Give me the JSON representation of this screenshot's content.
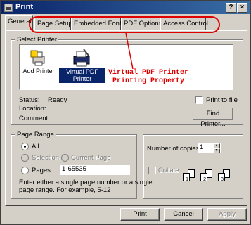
{
  "window": {
    "title": "Print",
    "close_glyph": "×",
    "help_glyph": "?"
  },
  "tabs": [
    {
      "label": "General"
    },
    {
      "label": "Page Setup"
    },
    {
      "label": "Embedded Fonts"
    },
    {
      "label": "PDF Options"
    },
    {
      "label": "Access Control"
    }
  ],
  "select_printer": {
    "group_title": "Select Printer",
    "printers": [
      {
        "label": "Add Printer",
        "icon": "add-printer-icon"
      },
      {
        "label_line1": "Virtual PDF",
        "label_line2": "Printer",
        "icon": "printer-icon"
      }
    ],
    "annotation_line1": "Virtual PDF Printer",
    "annotation_line2": "Printing Property",
    "status_label": "Status:",
    "status_value": "Ready",
    "location_label": "Location:",
    "comment_label": "Comment:",
    "print_to_file_label": "Print to file",
    "find_printer_label": "Find Printer..."
  },
  "page_range": {
    "group_title": "Page Range",
    "all_label": "All",
    "selection_label": "Selection",
    "current_page_label": "Current Page",
    "pages_label": "Pages:",
    "pages_value": "1-65535",
    "hint_line1": "Enter either a single page number or a single",
    "hint_line2": "page range.  For example, 5-12"
  },
  "copies": {
    "label": "Number of copies:",
    "value": "1",
    "collate_label": "Collate",
    "collate_pages": [
      "1",
      "1",
      "2",
      "2",
      "3",
      "3"
    ]
  },
  "buttons": {
    "print": "Print",
    "cancel": "Cancel",
    "apply": "Apply"
  },
  "colors": {
    "annotation": "#e00000",
    "selection": "#0a246a",
    "face": "#d4d0c8"
  }
}
